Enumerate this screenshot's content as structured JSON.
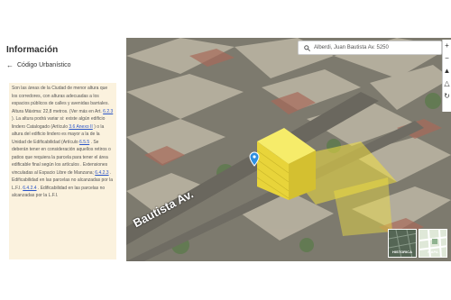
{
  "panel": {
    "title": "Información",
    "subtitle": "Código Urbanístico",
    "notes": [
      "Son las áreas de la Ciudad de menor altura que los corredores, con alturas adecuadas a los espacios públicos de calles y avenidas barriales. Altura Máxima: 22,8 metros. (Ver más en Art.",
      "6.2.3",
      "). La altura podrá variar si: existe algún edificio lindero Catalogado (Artículo",
      "3.6 Anexo II",
      ") o la altura del edificio lindero es mayor a la de la Unidad de Edificabilidad (Artículo",
      "6.5.5",
      ". Se deberán tener en consideración aquellos retiros o patios que requiera la parcela para tener el área edificable final según los artículos . Extensiones vinculadas al Espacio Libre de Manzana;",
      "6.4.2.3",
      ". Edificabilidad en las parcelas no alcanzadas por la L.F.I.",
      "6.4.2.4",
      ". Edificabilidad en las parcelas no",
      "alcanzadas por la L.F.I."
    ]
  },
  "map": {
    "search_text": "Alberdi, Juan Bautista Av. 5250",
    "street_label": "Bautista Av.",
    "zoom_in": "+",
    "zoom_out": "−",
    "layers": [
      {
        "label": "HISTORICA",
        "color": "#556655"
      },
      {
        "label": "MAPA",
        "color": "#8fb28f"
      }
    ],
    "accent_color": "#f2e040",
    "marker_color": "#2f8fe0"
  }
}
